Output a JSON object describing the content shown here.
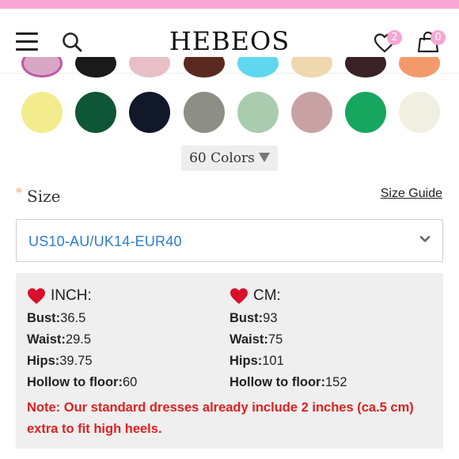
{
  "header": {
    "logo": "HEBEOS",
    "wishlist_count": "2",
    "cart_count": "0"
  },
  "colors": {
    "partial_row": [
      "#d9a6c6",
      "#1a1a1a",
      "#e8bfc7",
      "#5a2a20",
      "#5fd7ef",
      "#efd8ae",
      "#3a2226",
      "#f39a6b"
    ],
    "swatches": [
      "#f2ec8d",
      "#0e5635",
      "#10182a",
      "#8d8f86",
      "#a9ccae",
      "#c8a2a2",
      "#16a660",
      "#f1efe1"
    ],
    "toggle_label": "60 Colors"
  },
  "size": {
    "required_mark": "*",
    "label": "Size",
    "guide_link": "Size Guide",
    "selected": "US10-AU/UK14-EUR40"
  },
  "measurements": {
    "inch": {
      "title": "INCH:",
      "rows": [
        {
          "key": "Bust:",
          "value": "36.5"
        },
        {
          "key": "Waist:",
          "value": "29.5"
        },
        {
          "key": "Hips:",
          "value": "39.75"
        },
        {
          "key": "Hollow to floor:",
          "value": "60"
        }
      ]
    },
    "cm": {
      "title": "CM:",
      "rows": [
        {
          "key": "Bust:",
          "value": "93"
        },
        {
          "key": "Waist:",
          "value": "75"
        },
        {
          "key": "Hips:",
          "value": "101"
        },
        {
          "key": "Hollow to floor:",
          "value": "152"
        }
      ]
    },
    "note": "Note: Our standard dresses already include 2 inches (ca.5 cm) extra to fit high heels."
  },
  "accent_colors": {
    "pink": "#f7a6d4",
    "link_blue": "#2b7bd3",
    "note_red": "#e02020",
    "heart_red": "#d8102a"
  }
}
